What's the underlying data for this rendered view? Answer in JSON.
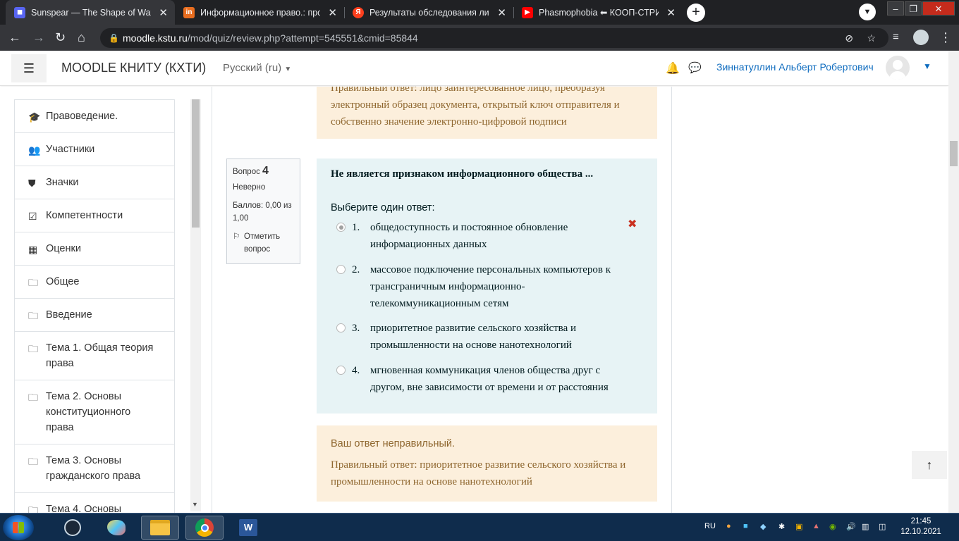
{
  "browser": {
    "tabs": [
      {
        "title": "Sunspear — The Shape of Wax",
        "favicon": "discord-icon",
        "color": "#5865f2"
      },
      {
        "title": "Информационное право.: прос",
        "favicon": "studfiles-icon",
        "color": "#e86d1f"
      },
      {
        "title": "Результаты обследования лица,",
        "favicon": "yandex-icon",
        "color": "#fc3f1d"
      },
      {
        "title": "Phasmophobia ⬅ КООП-СТРИМ",
        "favicon": "youtube-icon",
        "color": "#ff0000"
      }
    ],
    "url_host": "moodle.kstu.ru",
    "url_path": "/mod/quiz/review.php?attempt=545551&cmid=85844"
  },
  "header": {
    "brand": "MOODLE КНИТУ (КХТИ)",
    "language": "Русский (ru)",
    "user_name": "Зиннатуллин Альберт Робертович"
  },
  "drawer": {
    "items": [
      {
        "label": "Правоведение.",
        "icon": "graduation-cap-icon",
        "glyph": "🎓"
      },
      {
        "label": "Участники",
        "icon": "users-icon",
        "glyph": "👥"
      },
      {
        "label": "Значки",
        "icon": "shield-icon",
        "glyph": "⛊"
      },
      {
        "label": "Компетентности",
        "icon": "checkbox-icon",
        "glyph": "☑"
      },
      {
        "label": "Оценки",
        "icon": "table-icon",
        "glyph": "▦"
      },
      {
        "label": "Общее",
        "icon": "folder-icon",
        "glyph": "🗀"
      },
      {
        "label": "Введение",
        "icon": "folder-icon",
        "glyph": "🗀"
      },
      {
        "label": "Тема 1. Общая теория права",
        "icon": "folder-icon",
        "glyph": "🗀"
      },
      {
        "label": "Тема 2. Основы конституционного права",
        "icon": "folder-icon",
        "glyph": "🗀"
      },
      {
        "label": "Тема 3. Основы гражданского права",
        "icon": "folder-icon",
        "glyph": "🗀"
      },
      {
        "label": "Тема 4. Основы",
        "icon": "folder-icon",
        "glyph": "🗀"
      }
    ]
  },
  "previous_feedback": {
    "line1": "Правильный ответ: лицо заинтересованное лицо, преобразуя",
    "line2": "электронный образец документа, открытый ключ отправителя и",
    "line3": "собственно значение электронно-цифровой подписи"
  },
  "question": {
    "label": "Вопрос",
    "number": "4",
    "state": "Неверно",
    "grade": "Баллов: 0,00 из 1,00",
    "flag": "Отметить вопрос",
    "text": "Не является признаком информационного общества ...",
    "prompt": "Выберите один ответ:",
    "answers": [
      {
        "num": "1.",
        "text": "общедоступность и постоянное обновление информационных данных",
        "selected": true
      },
      {
        "num": "2.",
        "text": "массовое подключение персональных компьютеров к трансграничным информационно-телекоммуникационным сетям",
        "selected": false
      },
      {
        "num": "3.",
        "text": "приоритетное развитие сельского хозяйства и промышленности на основе нанотехнологий",
        "selected": false
      },
      {
        "num": "4.",
        "text": "мгновенная коммуникация членов общества друг с другом, вне зависимости от времени и от расстояния",
        "selected": false
      }
    ]
  },
  "feedback": {
    "status": "Ваш ответ неправильный.",
    "right_answer": "Правильный ответ: приоритетное развитие сельского хозяйства и промышленности на основе нанотехнологий"
  },
  "taskbar": {
    "lang": "RU",
    "time": "21:45",
    "date": "12.10.2021"
  },
  "colors": {
    "accent": "#0f6cbf",
    "question_bg": "#e7f3f5",
    "feedback_bg": "#fcefdc",
    "wrong": "#ca3120"
  }
}
